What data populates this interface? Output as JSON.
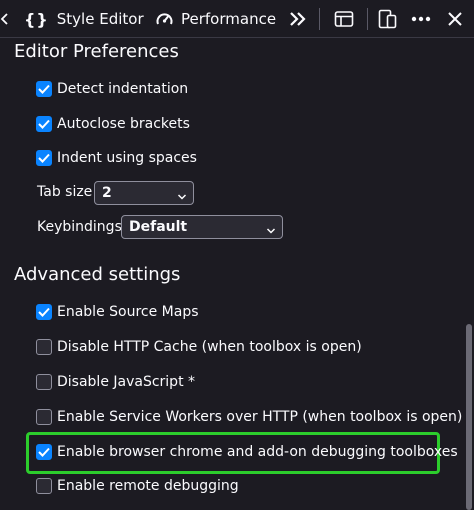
{
  "toolbar": {
    "tabs": [
      {
        "label": "Style Editor",
        "icon": "braces-icon"
      },
      {
        "label": "Performance",
        "icon": "gauge-icon"
      }
    ],
    "more_tabs_icon": "double-chevron-right-icon",
    "icons": [
      "dock-panel-icon",
      "responsive-design-icon",
      "more-options-icon",
      "close-icon"
    ]
  },
  "editor_preferences": {
    "title": "Editor Preferences",
    "options": [
      {
        "label": "Detect indentation",
        "checked": true
      },
      {
        "label": "Autoclose brackets",
        "checked": true
      },
      {
        "label": "Indent using spaces",
        "checked": true
      }
    ],
    "tab_size": {
      "label": "Tab size",
      "value": "2"
    },
    "keybindings": {
      "label": "Keybindings",
      "value": "Default"
    }
  },
  "advanced_settings": {
    "title": "Advanced settings",
    "options": [
      {
        "label": "Enable Source Maps",
        "checked": true
      },
      {
        "label": "Disable HTTP Cache (when toolbox is open)",
        "checked": false
      },
      {
        "label": "Disable JavaScript *",
        "checked": false
      },
      {
        "label": "Enable Service Workers over HTTP (when toolbox is open)",
        "checked": false
      },
      {
        "label": "Enable browser chrome and add-on debugging toolboxes",
        "checked": true
      },
      {
        "label": "Enable remote debugging",
        "checked": false
      }
    ]
  },
  "colors": {
    "background": "#1c1b22",
    "checkbox_accent": "#0a84ff",
    "highlight": "#2ccd2c"
  }
}
